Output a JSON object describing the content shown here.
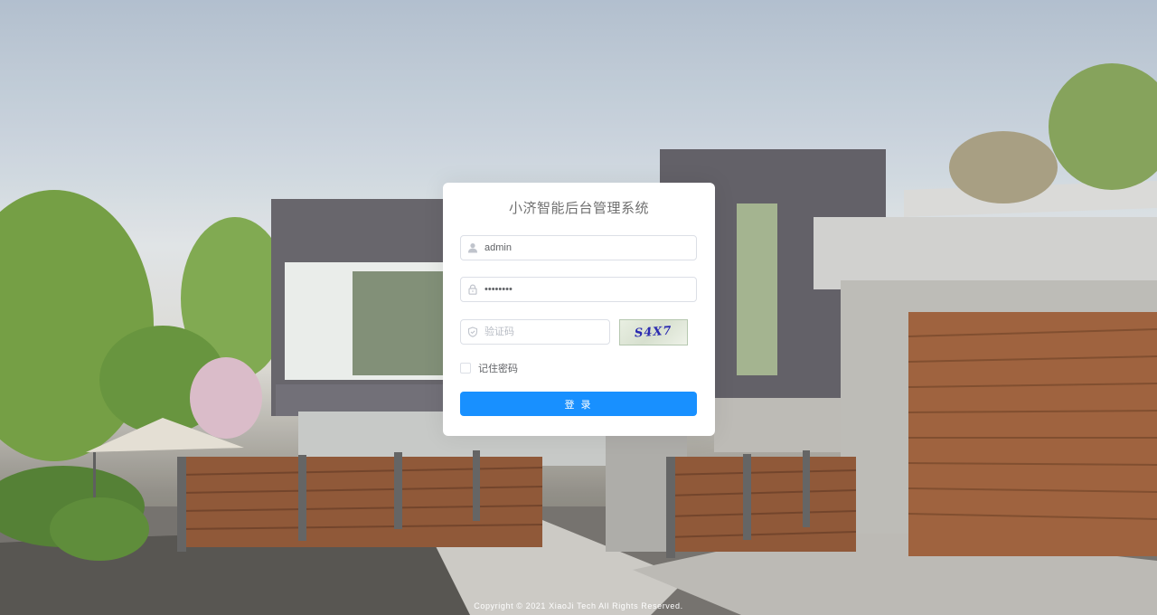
{
  "card": {
    "title": "小济智能后台管理系统",
    "username": {
      "value": "admin",
      "icon": "user-icon"
    },
    "password": {
      "value": "••••••••",
      "icon": "lock-icon"
    },
    "captcha_input": {
      "placeholder": "验证码",
      "icon": "shield-icon"
    },
    "captcha_image_text": "S4X7",
    "remember_label": "记住密码",
    "login_label": "登 录"
  },
  "footer": {
    "copyright": "Copyright © 2021 XiaoJi Tech All Rights Reserved."
  },
  "colors": {
    "primary": "#1890ff",
    "card_bg": "#ffffff"
  }
}
